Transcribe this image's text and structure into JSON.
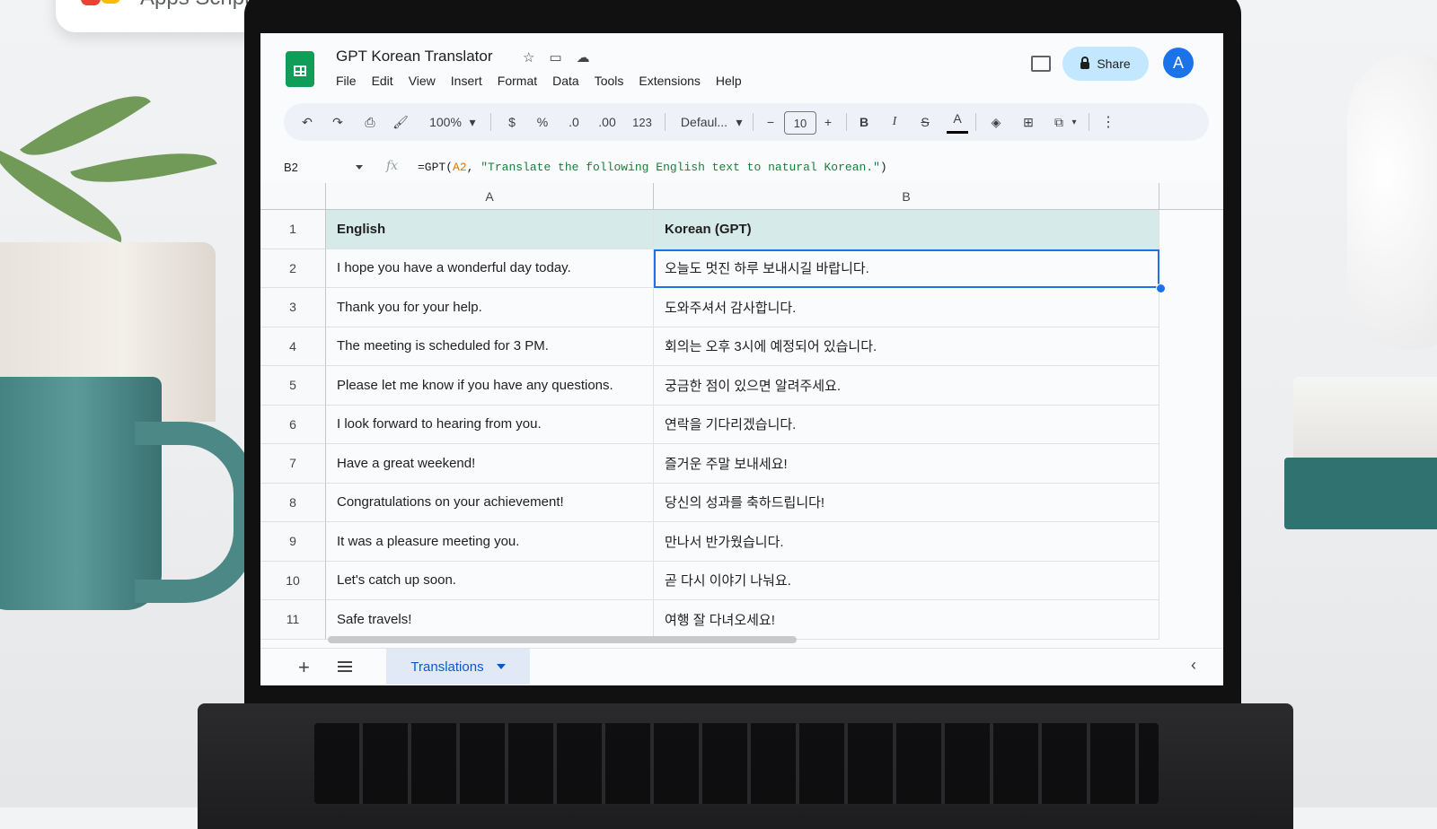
{
  "overlay": {
    "apps_script_label": "Apps Script"
  },
  "document": {
    "title": "GPT Korean Translator"
  },
  "menu": [
    "File",
    "Edit",
    "View",
    "Insert",
    "Format",
    "Data",
    "Tools",
    "Extensions",
    "Help"
  ],
  "header": {
    "share_label": "Share",
    "avatar_initial": "A"
  },
  "toolbar": {
    "zoom": "100%",
    "currency": "$",
    "percent": "%",
    "decrease_decimal": ".0",
    "increase_decimal": ".00",
    "number_format": "123",
    "font": "Defaul...",
    "font_size": "10",
    "minus": "−",
    "plus": "+",
    "bold": "B",
    "italic": "I",
    "strikethrough": "S",
    "text_color": "A"
  },
  "formula_bar": {
    "cell_ref": "B2",
    "fx": "fx",
    "prefix": "=GPT(",
    "arg_ref": "A2",
    "separator": ", ",
    "arg_string": "\"Translate the following English text to natural Korean.\"",
    "suffix": ")"
  },
  "columns": [
    "A",
    "B"
  ],
  "rows": [
    {
      "num": "1",
      "a": "English",
      "b": "Korean (GPT)"
    },
    {
      "num": "2",
      "a": "I hope you have a wonderful day today.",
      "b": "오늘도 멋진 하루 보내시길 바랍니다."
    },
    {
      "num": "3",
      "a": "Thank you for your help.",
      "b": "도와주셔서 감사합니다."
    },
    {
      "num": "4",
      "a": "The meeting is scheduled for 3 PM.",
      "b": "회의는 오후 3시에 예정되어 있습니다."
    },
    {
      "num": "5",
      "a": "Please let me know if you have any questions.",
      "b": "궁금한 점이 있으면 알려주세요."
    },
    {
      "num": "6",
      "a": "I look forward to hearing from you.",
      "b": "연락을 기다리겠습니다."
    },
    {
      "num": "7",
      "a": "Have a great weekend!",
      "b": "즐거운 주말 보내세요!"
    },
    {
      "num": "8",
      "a": "Congratulations on your achievement!",
      "b": "당신의 성과를 축하드립니다!"
    },
    {
      "num": "9",
      "a": "It was a pleasure meeting you.",
      "b": "만나서 반가웠습니다."
    },
    {
      "num": "10",
      "a": "Let's catch up soon.",
      "b": "곧 다시 이야기 나눠요."
    },
    {
      "num": "11",
      "a": "Safe travels!",
      "b": "여행 잘 다녀오세요!"
    }
  ],
  "selection": {
    "row": 2,
    "column": "B"
  },
  "sheet_tabs": [
    {
      "label": "Translations",
      "active": true
    }
  ],
  "colors": {
    "header_fill": "#d6ebe9",
    "selection": "#1a73e8",
    "share_button": "#c2e7ff",
    "sheets_green": "#0f9d58",
    "formula_ref": "#e37400",
    "formula_string": "#188038"
  }
}
